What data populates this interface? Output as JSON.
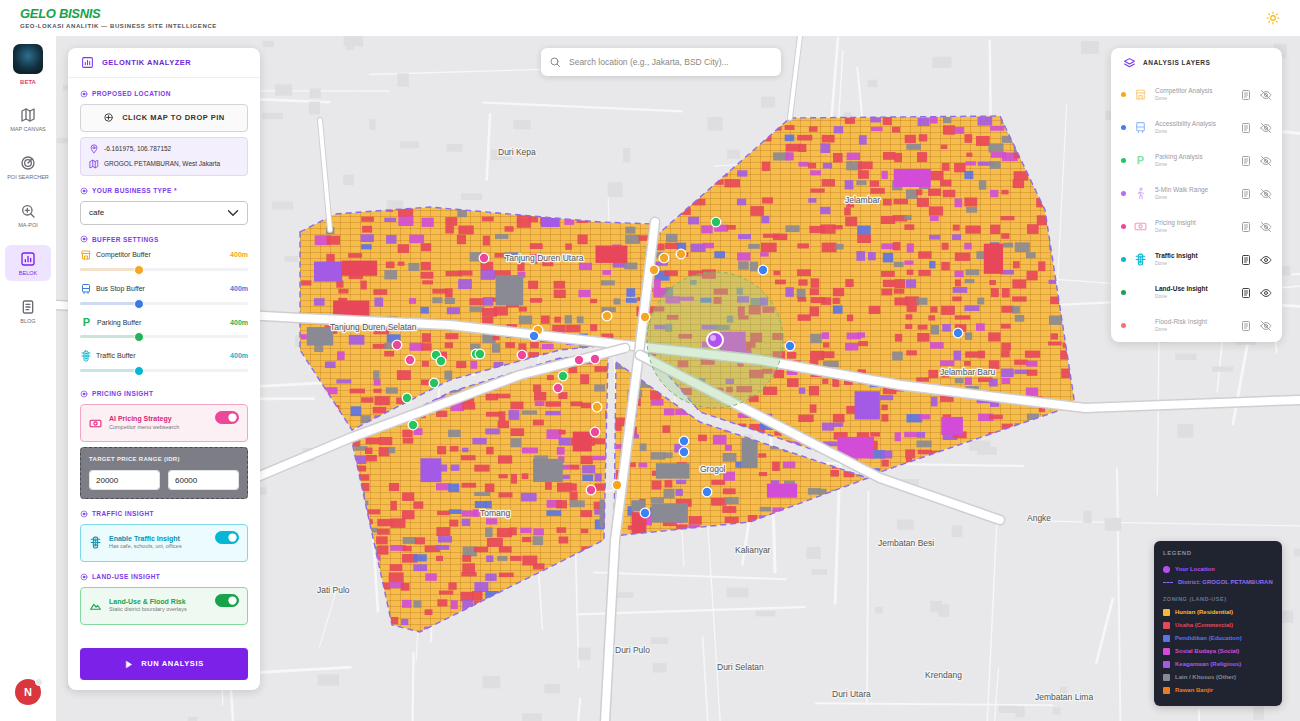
{
  "header": {
    "brand": "GELO BISNIS",
    "tagline": "GEO-LOKASI ANALITIK — BUSINESS SITE INTELLIGENCE"
  },
  "rail": {
    "badge": "BETA",
    "items": [
      {
        "label": "MAP CANVAS",
        "selected": false
      },
      {
        "label": "POI SEARCHER",
        "selected": false
      },
      {
        "label": "MA-POI",
        "selected": false
      },
      {
        "label": "BELOK",
        "selected": true
      },
      {
        "label": "BLOG",
        "selected": false
      }
    ],
    "avatar": "N"
  },
  "analyzer": {
    "title": "GELONTIK ANALYZER",
    "location": {
      "heading": "PROPOSED LOCATION",
      "button": "CLICK MAP TO DROP PIN",
      "coords": "-6.161975, 106.787152",
      "district": "GROGOL PETAMBURAN, West Jakarta"
    },
    "business": {
      "heading": "YOUR BUSINESS TYPE *",
      "value": "cafe"
    },
    "buffers": {
      "heading": "BUFFER SETTINGS",
      "items": [
        {
          "label": "Competitor Buffer",
          "reading": "400m",
          "level": 0.35,
          "color": "#f5a623",
          "kind": "competitor"
        },
        {
          "label": "Bus Stop Buffer",
          "reading": "400m",
          "level": 0.35,
          "color": "#3b7be0",
          "kind": "accessibility"
        },
        {
          "label": "Parking Buffer",
          "reading": "400m",
          "level": 0.35,
          "color": "#22b55a",
          "kind": "parking",
          "glyph": "P"
        },
        {
          "label": "Traffic Buffer",
          "reading": "400m",
          "level": 0.35,
          "color": "#06b6d4",
          "kind": "traffic"
        }
      ]
    },
    "pricing": {
      "heading": "PRICING INSIGHT",
      "toggle": {
        "title": "AI Pricing Strategy",
        "subtitle": "Competitor menu websearch",
        "on": true
      },
      "range": {
        "label": "TARGET PRICE RANGE (IDR)",
        "min": "20000",
        "max": "60000"
      }
    },
    "traffic": {
      "heading": "TRAFFIC INSIGHT",
      "toggle": {
        "title": "Enable Traffic Insight",
        "subtitle": "Has cafe, schools, uni, offices",
        "on": true
      }
    },
    "landuse": {
      "heading": "LAND-USE INSIGHT",
      "toggle": {
        "title": "Land-Use & Flood Risk",
        "subtitle": "Static district boundary overlays",
        "on": true
      }
    },
    "run_button": "RUN ANALYSIS"
  },
  "search": {
    "placeholder": "Search location (e.g., Jakarta, BSD City)..."
  },
  "layers": {
    "title": "ANALYSIS LAYERS",
    "items": [
      {
        "title": "Competitor Analysis",
        "status": "Done",
        "visible": false,
        "color": "#f5a623",
        "kind": "competitor"
      },
      {
        "title": "Accessibility Analysis",
        "status": "Done",
        "visible": false,
        "color": "#3b82f6",
        "kind": "accessibility"
      },
      {
        "title": "Parking Analysis",
        "status": "Done",
        "visible": false,
        "color": "#22c55e",
        "kind": "parking",
        "glyph": "P"
      },
      {
        "title": "5-Min Walk Range",
        "status": "Done",
        "visible": false,
        "color": "#b86cf0",
        "kind": "walk"
      },
      {
        "title": "Pricing Insight",
        "status": "Done",
        "visible": false,
        "color": "#ec4899",
        "kind": "pricing"
      },
      {
        "title": "Traffic Insight",
        "status": "Done",
        "visible": true,
        "color": "#06b6d4",
        "kind": "traffic"
      },
      {
        "title": "Land-Use Insight",
        "status": "Done",
        "visible": true,
        "color": "#16a34a",
        "kind": "landuse"
      },
      {
        "title": "Flood-Risk Insight",
        "status": "Done",
        "visible": false,
        "color": "#f87171",
        "kind": "flood"
      }
    ]
  },
  "legend": {
    "title": "LEGEND",
    "location": {
      "label": "Your Location",
      "color": "#b44ff0"
    },
    "district": {
      "label": "District: GROGOL PETAMBURAN",
      "color": "#8b6cf0"
    },
    "zoning_title": "ZONING (LAND-USE)",
    "zones": [
      {
        "label": "Hunian (Residential)",
        "color": "#f6b93b"
      },
      {
        "label": "Usaha (Commercial)",
        "color": "#e8475a"
      },
      {
        "label": "Pendidikan (Education)",
        "color": "#5a73e6"
      },
      {
        "label": "Sosial Budaya (Social)",
        "color": "#d24cd8"
      },
      {
        "label": "Keagamaan (Religious)",
        "color": "#a35be6"
      },
      {
        "label": "Lain / Khusus (Other)",
        "color": "#8a8a94"
      },
      {
        "label": "Rawan Banjir",
        "color": "#f07b22"
      }
    ]
  },
  "map": {
    "labels": [
      "Duri Kepa",
      "Tanjung Duren Utara",
      "Tanjung Duren Selatan",
      "Jelambar",
      "Jelambar Baru",
      "Tomang",
      "Grogol",
      "Angke",
      "Kalianyar",
      "Jembatan Besi",
      "Jati Pulo",
      "Duri Pulo",
      "Duri Selatan",
      "Krendang",
      "Duri Utara",
      "Jembatan Lima"
    ],
    "markers": [
      {
        "kind": "competitor"
      },
      {
        "kind": "competitor"
      },
      {
        "kind": "competitor"
      },
      {
        "kind": "competitor"
      },
      {
        "kind": "competitor"
      },
      {
        "kind": "competitor"
      },
      {
        "kind": "competitor"
      },
      {
        "kind": "competitor"
      },
      {
        "kind": "accessibility"
      },
      {
        "kind": "accessibility"
      },
      {
        "kind": "accessibility"
      },
      {
        "kind": "accessibility"
      },
      {
        "kind": "accessibility"
      },
      {
        "kind": "accessibility"
      },
      {
        "kind": "accessibility"
      },
      {
        "kind": "accessibility"
      },
      {
        "kind": "parking"
      },
      {
        "kind": "parking"
      },
      {
        "kind": "parking"
      },
      {
        "kind": "parking"
      },
      {
        "kind": "parking"
      },
      {
        "kind": "parking"
      },
      {
        "kind": "parking"
      },
      {
        "kind": "parking"
      },
      {
        "kind": "parking"
      },
      {
        "kind": "pricing"
      },
      {
        "kind": "pricing"
      },
      {
        "kind": "pricing"
      },
      {
        "kind": "pricing"
      },
      {
        "kind": "pricing"
      },
      {
        "kind": "pricing"
      },
      {
        "kind": "pricing"
      },
      {
        "kind": "pricing"
      },
      {
        "kind": "pricing"
      }
    ]
  }
}
